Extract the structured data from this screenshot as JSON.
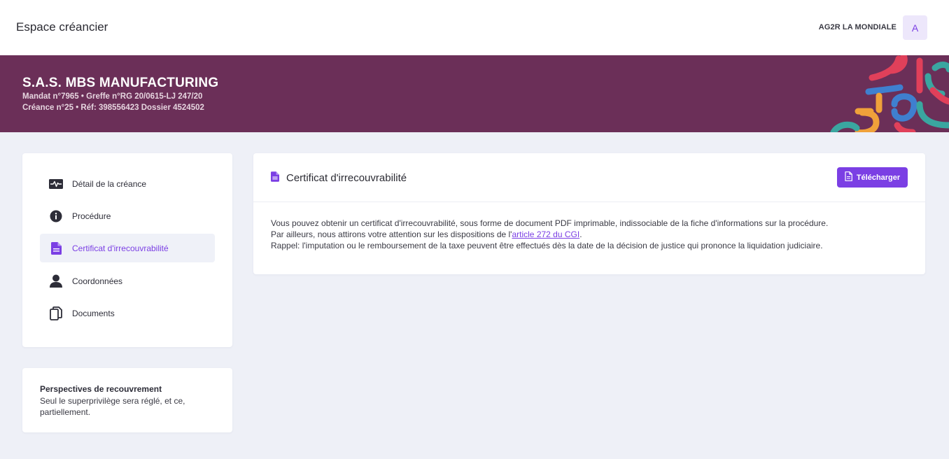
{
  "header": {
    "app_title": "Espace créancier",
    "org_name": "AG2R LA MONDIALE",
    "avatar_letter": "A"
  },
  "banner": {
    "company": "S.A.S. MBS MANUFACTURING",
    "line1": "Mandat n°7965 • Greffe n°RG 20/0615-LJ 247/20",
    "line2": "Créance n°25 • Réf: 398556423 Dossier 4524502"
  },
  "sidebar": {
    "items": [
      {
        "label": "Détail de la créance",
        "icon": "pulse-icon"
      },
      {
        "label": "Procédure",
        "icon": "info-icon"
      },
      {
        "label": "Certificat d'irrecouvrabilité",
        "icon": "document-icon",
        "active": true
      },
      {
        "label": "Coordonnées",
        "icon": "user-icon"
      },
      {
        "label": "Documents",
        "icon": "copy-icon"
      }
    ]
  },
  "perspectives": {
    "title": "Perspectives de recouvrement",
    "text": "Seul le superprivilège sera réglé, et ce, partiellement."
  },
  "main": {
    "title": "Certificat d'irrecouvrabilité",
    "download_label": "Télécharger",
    "para1": "Vous pouvez obtenir un certificat d'irrecouvrabilité, sous forme de document PDF imprimable, indissociable de la fiche d'informations sur la procédure.",
    "para2_prefix": "Par ailleurs, nous attirons votre attention sur les dispositions de l'",
    "para2_link": "article 272 du CGI",
    "para2_suffix": ".",
    "para3": "Rappel: l'imputation ou le remboursement de la taxe peuvent être effectués dès la date de la décision de justice qui prononce la liquidation judiciaire."
  },
  "colors": {
    "accent": "#7b3fe4",
    "banner": "#6b2f58",
    "background": "#eef0f7"
  }
}
